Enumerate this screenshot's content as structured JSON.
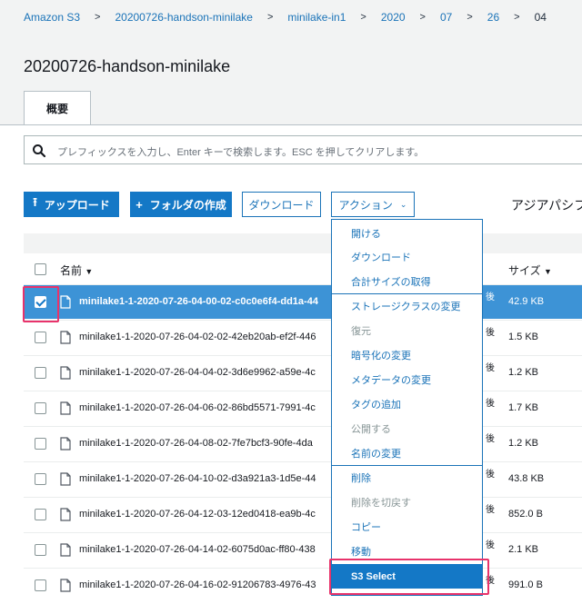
{
  "breadcrumb": [
    "Amazon S3",
    "20200726-handson-minilake",
    "minilake-in1",
    "2020",
    "07",
    "26",
    "04"
  ],
  "page_title": "20200726-handson-minilake",
  "tabs": {
    "overview": "概要"
  },
  "search": {
    "placeholder": "プレフィックスを入力し、Enter キーで検索します。ESC を押してクリアします。"
  },
  "toolbar": {
    "upload_label": "アップロード",
    "create_folder_label": "フォルダの作成",
    "download_label": "ダウンロード",
    "actions_label": "アクション",
    "region_text": "アジアパシフ"
  },
  "table": {
    "col_name": "名前",
    "col_size": "サイズ",
    "rows": [
      {
        "name": "minilake1-1-2020-07-26-04-00-02-c0c0e6f4-dd1a-44",
        "suffix": "後",
        "size": "42.9 KB",
        "selected": true
      },
      {
        "name": "minilake1-1-2020-07-26-04-02-02-42eb20ab-ef2f-446",
        "suffix": "後",
        "size": "1.5 KB",
        "selected": false
      },
      {
        "name": "minilake1-1-2020-07-26-04-04-02-3d6e9962-a59e-4c",
        "suffix": "後",
        "size": "1.2 KB",
        "selected": false
      },
      {
        "name": "minilake1-1-2020-07-26-04-06-02-86bd5571-7991-4c",
        "suffix": "後",
        "size": "1.7 KB",
        "selected": false
      },
      {
        "name": "minilake1-1-2020-07-26-04-08-02-7fe7bcf3-90fe-4da",
        "suffix": "後",
        "size": "1.2 KB",
        "selected": false
      },
      {
        "name": "minilake1-1-2020-07-26-04-10-02-d3a921a3-1d5e-44",
        "suffix": "後",
        "size": "43.8 KB",
        "selected": false
      },
      {
        "name": "minilake1-1-2020-07-26-04-12-03-12ed0418-ea9b-4c",
        "suffix": "後",
        "size": "852.0 B",
        "selected": false
      },
      {
        "name": "minilake1-1-2020-07-26-04-14-02-6075d0ac-ff80-438",
        "suffix": "後",
        "size": "2.1 KB",
        "selected": false
      },
      {
        "name": "minilake1-1-2020-07-26-04-16-02-91206783-4976-43",
        "suffix": "後",
        "size": "991.0 B",
        "selected": false
      }
    ]
  },
  "actions_menu": [
    {
      "label": "開ける",
      "disabled": false
    },
    {
      "label": "ダウンロード",
      "disabled": false
    },
    {
      "label": "合計サイズの取得",
      "disabled": false
    },
    {
      "label": "ストレージクラスの変更",
      "disabled": false
    },
    {
      "label": "復元",
      "disabled": true
    },
    {
      "label": "暗号化の変更",
      "disabled": false
    },
    {
      "label": "メタデータの変更",
      "disabled": false
    },
    {
      "label": "タグの追加",
      "disabled": false
    },
    {
      "label": "公開する",
      "disabled": true
    },
    {
      "label": "名前の変更",
      "disabled": false
    },
    {
      "label": "削除",
      "disabled": false
    },
    {
      "label": "削除を切戻す",
      "disabled": true
    },
    {
      "label": "コピー",
      "disabled": false
    },
    {
      "label": "移動",
      "disabled": false
    },
    {
      "label": "S3 Select",
      "disabled": false,
      "active": true
    }
  ],
  "colors": {
    "accent": "#1478c6",
    "link": "#1a73b8",
    "selected_row": "#3d93d6",
    "highlight": "#e8336b"
  }
}
